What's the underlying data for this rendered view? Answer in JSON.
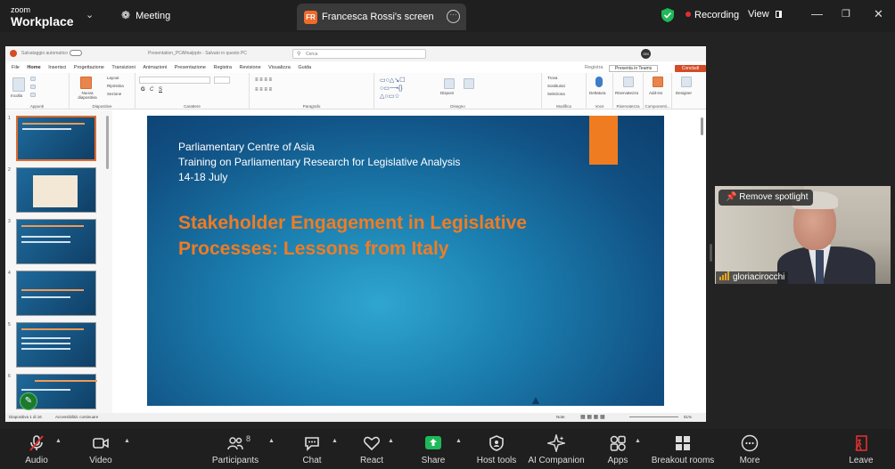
{
  "topbar": {
    "logo_line1": "zoom",
    "logo_line2": "Workplace",
    "meeting_label": "Meeting",
    "share_tab": {
      "avatar": "FR",
      "title": "Francesca Rossi's screen"
    },
    "recording_label": "Recording",
    "view_label": "View"
  },
  "app": {
    "title": "Presentation_PCAfinalpptx - Salvato in questo PC",
    "search_placeholder": "Cerca",
    "autosave": "Salvataggio automatico",
    "menu": [
      "File",
      "Home",
      "Inserisci",
      "Progettazione",
      "Transizioni",
      "Animazioni",
      "Presentazione",
      "Registra",
      "Revisione",
      "Visualizza",
      "Guida"
    ],
    "record_btn": "Registra",
    "teams_btn": "Presenta in Teams",
    "conclude_btn": "Concludi",
    "ribbon_groups": [
      "Appunti",
      "Diapositive",
      "Carattere",
      "Paragrafo",
      "Disegno",
      "Modifica",
      "Voce",
      "Riservatezza",
      "Componenti..."
    ],
    "ribbon_labels": {
      "incolla": "Incolla",
      "nuova": "Nuova diapositiva",
      "layout": "Layout",
      "ripristina": "Ripristina",
      "sezione": "Sezione",
      "forme": "Forme",
      "disponi": "Disponi",
      "trova": "Trova",
      "sostituisci": "Sostituisci",
      "seleziona": "Seleziona",
      "dettatura": "Dettatura",
      "riservatezza": "Riservatezza",
      "addins": "Add-ins",
      "designer": "Designer"
    },
    "thumb_numbers": [
      "1",
      "2",
      "3",
      "4",
      "5",
      "6"
    ],
    "status_left": "Diapositiva 1 di 16",
    "status_access": "Accessibilità: continuare",
    "status_note": "Note",
    "zoom_level": "51%"
  },
  "slide": {
    "line1": "Parliamentary Centre of Asia",
    "line2": "Training on Parliamentary Research for Legislative Analysis",
    "line3": "14-18 July",
    "heading": "Stakeholder Engagement in Legislative Processes: Lessons from Italy"
  },
  "video": {
    "spotlight_label": "Remove spotlight",
    "participant_name": "gloriacirocchi"
  },
  "toolbar": {
    "audio": "Audio",
    "video": "Video",
    "participants": "Participants",
    "participants_count": "8",
    "chat": "Chat",
    "react": "React",
    "share": "Share",
    "host_tools": "Host tools",
    "ai_companion": "AI Companion",
    "apps": "Apps",
    "breakout": "Breakout rooms",
    "more": "More",
    "leave": "Leave"
  },
  "colors": {
    "share_green": "#1fb85a",
    "leave_red": "#e02f2f",
    "slide_accent": "#f07c22",
    "recording_red": "#e02f2f"
  }
}
